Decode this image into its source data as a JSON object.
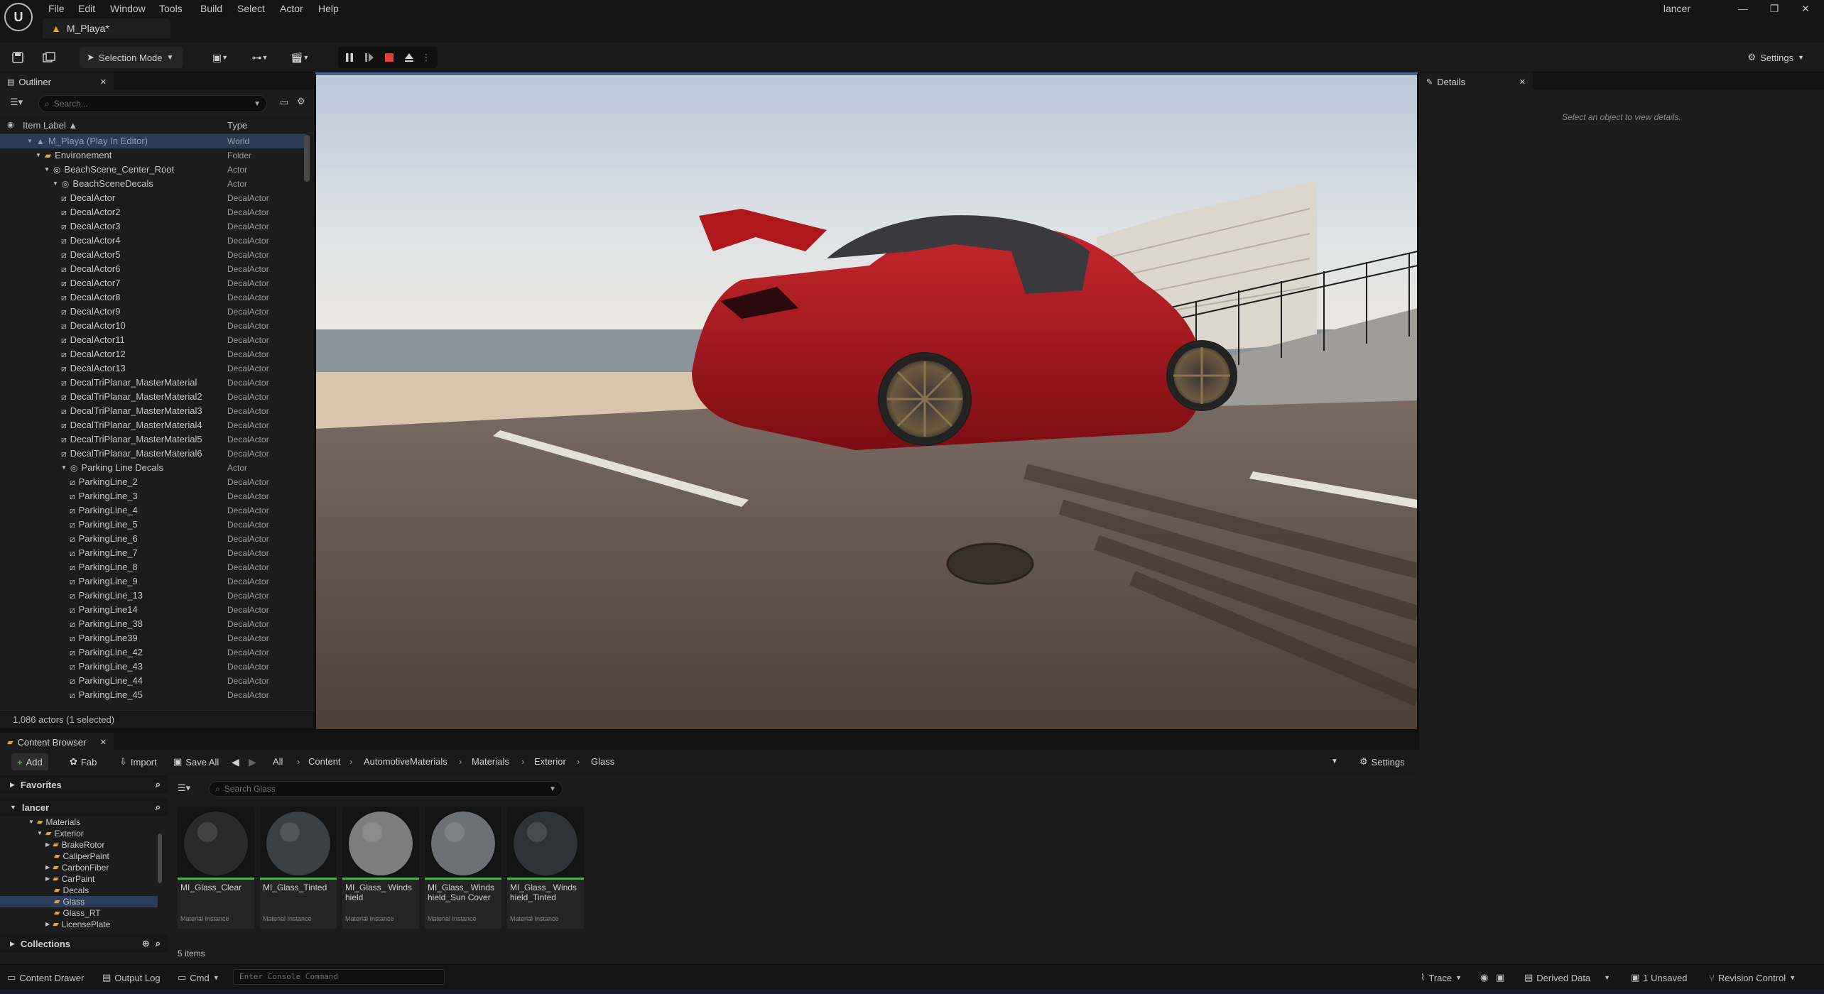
{
  "menu": [
    "File",
    "Edit",
    "Window",
    "Tools",
    "Build",
    "Select",
    "Actor",
    "Help"
  ],
  "level_tab": "M_Playa*",
  "user": "lancer",
  "toolbar": {
    "selection_mode": "Selection Mode",
    "settings": "Settings"
  },
  "outliner": {
    "tab": "Outliner",
    "search_placeholder": "Search...",
    "col_label": "Item Label ▲",
    "col_type": "Type",
    "rows": [
      {
        "label": "M_Playa (Play In Editor)",
        "type": "World",
        "depth": 0,
        "kind": "world",
        "expanded": true
      },
      {
        "label": "Environement",
        "type": "Folder",
        "depth": 1,
        "kind": "folder",
        "expanded": true
      },
      {
        "label": "BeachScene_Center_Root",
        "type": "Actor",
        "depth": 2,
        "kind": "actor",
        "expanded": true
      },
      {
        "label": "BeachSceneDecals",
        "type": "Actor",
        "depth": 3,
        "kind": "actor",
        "expanded": true
      },
      {
        "label": "DecalActor",
        "type": "DecalActor",
        "depth": 4,
        "kind": "decal"
      },
      {
        "label": "DecalActor2",
        "type": "DecalActor",
        "depth": 4,
        "kind": "decal"
      },
      {
        "label": "DecalActor3",
        "type": "DecalActor",
        "depth": 4,
        "kind": "decal"
      },
      {
        "label": "DecalActor4",
        "type": "DecalActor",
        "depth": 4,
        "kind": "decal"
      },
      {
        "label": "DecalActor5",
        "type": "DecalActor",
        "depth": 4,
        "kind": "decal"
      },
      {
        "label": "DecalActor6",
        "type": "DecalActor",
        "depth": 4,
        "kind": "decal"
      },
      {
        "label": "DecalActor7",
        "type": "DecalActor",
        "depth": 4,
        "kind": "decal"
      },
      {
        "label": "DecalActor8",
        "type": "DecalActor",
        "depth": 4,
        "kind": "decal"
      },
      {
        "label": "DecalActor9",
        "type": "DecalActor",
        "depth": 4,
        "kind": "decal"
      },
      {
        "label": "DecalActor10",
        "type": "DecalActor",
        "depth": 4,
        "kind": "decal"
      },
      {
        "label": "DecalActor11",
        "type": "DecalActor",
        "depth": 4,
        "kind": "decal"
      },
      {
        "label": "DecalActor12",
        "type": "DecalActor",
        "depth": 4,
        "kind": "decal"
      },
      {
        "label": "DecalActor13",
        "type": "DecalActor",
        "depth": 4,
        "kind": "decal"
      },
      {
        "label": "DecalTriPlanar_MasterMaterial",
        "type": "DecalActor",
        "depth": 4,
        "kind": "decal"
      },
      {
        "label": "DecalTriPlanar_MasterMaterial2",
        "type": "DecalActor",
        "depth": 4,
        "kind": "decal"
      },
      {
        "label": "DecalTriPlanar_MasterMaterial3",
        "type": "DecalActor",
        "depth": 4,
        "kind": "decal"
      },
      {
        "label": "DecalTriPlanar_MasterMaterial4",
        "type": "DecalActor",
        "depth": 4,
        "kind": "decal"
      },
      {
        "label": "DecalTriPlanar_MasterMaterial5",
        "type": "DecalActor",
        "depth": 4,
        "kind": "decal"
      },
      {
        "label": "DecalTriPlanar_MasterMaterial6",
        "type": "DecalActor",
        "depth": 4,
        "kind": "decal"
      },
      {
        "label": "Parking Line Decals",
        "type": "Actor",
        "depth": 4,
        "kind": "actor",
        "expanded": true
      },
      {
        "label": "ParkingLine_2",
        "type": "DecalActor",
        "depth": 5,
        "kind": "decal"
      },
      {
        "label": "ParkingLine_3",
        "type": "DecalActor",
        "depth": 5,
        "kind": "decal"
      },
      {
        "label": "ParkingLine_4",
        "type": "DecalActor",
        "depth": 5,
        "kind": "decal"
      },
      {
        "label": "ParkingLine_5",
        "type": "DecalActor",
        "depth": 5,
        "kind": "decal"
      },
      {
        "label": "ParkingLine_6",
        "type": "DecalActor",
        "depth": 5,
        "kind": "decal"
      },
      {
        "label": "ParkingLine_7",
        "type": "DecalActor",
        "depth": 5,
        "kind": "decal"
      },
      {
        "label": "ParkingLine_8",
        "type": "DecalActor",
        "depth": 5,
        "kind": "decal"
      },
      {
        "label": "ParkingLine_9",
        "type": "DecalActor",
        "depth": 5,
        "kind": "decal"
      },
      {
        "label": "ParkingLine_13",
        "type": "DecalActor",
        "depth": 5,
        "kind": "decal"
      },
      {
        "label": "ParkingLine14",
        "type": "DecalActor",
        "depth": 5,
        "kind": "decal"
      },
      {
        "label": "ParkingLine_38",
        "type": "DecalActor",
        "depth": 5,
        "kind": "decal"
      },
      {
        "label": "ParkingLine39",
        "type": "DecalActor",
        "depth": 5,
        "kind": "decal"
      },
      {
        "label": "ParkingLine_42",
        "type": "DecalActor",
        "depth": 5,
        "kind": "decal"
      },
      {
        "label": "ParkingLine_43",
        "type": "DecalActor",
        "depth": 5,
        "kind": "decal"
      },
      {
        "label": "ParkingLine_44",
        "type": "DecalActor",
        "depth": 5,
        "kind": "decal"
      },
      {
        "label": "ParkingLine_45",
        "type": "DecalActor",
        "depth": 5,
        "kind": "decal"
      }
    ],
    "status": "1,086 actors (1 selected)"
  },
  "details": {
    "tab": "Details",
    "empty": "Select an object to view details."
  },
  "content_browser": {
    "tab": "Content Browser",
    "add": "Add",
    "fab": "Fab",
    "import": "Import",
    "save_all": "Save All",
    "settings": "Settings",
    "breadcrumb": [
      "All",
      "Content",
      "AutomotiveMaterials",
      "Materials",
      "Exterior",
      "Glass"
    ],
    "favorites": "Favorites",
    "project": "lancer",
    "collections": "Collections",
    "search_placeholder": "Search Glass",
    "tree": [
      {
        "label": "Materials",
        "depth": 0,
        "expanded": true
      },
      {
        "label": "Exterior",
        "depth": 1,
        "expanded": true
      },
      {
        "label": "BrakeRotor",
        "depth": 2,
        "expanded": false
      },
      {
        "label": "CaliperPaint",
        "depth": 2
      },
      {
        "label": "CarbonFiber",
        "depth": 2,
        "expanded": false
      },
      {
        "label": "CarPaint",
        "depth": 2,
        "expanded": false
      },
      {
        "label": "Decals",
        "depth": 2
      },
      {
        "label": "Glass",
        "depth": 2,
        "selected": true
      },
      {
        "label": "Glass_RT",
        "depth": 2
      },
      {
        "label": "LicensePlate",
        "depth": 2,
        "expanded": false
      }
    ],
    "assets": [
      {
        "name": "MI_Glass_Clear",
        "type": "Material Instance"
      },
      {
        "name": "MI_Glass_Tinted",
        "type": "Material Instance"
      },
      {
        "name": "MI_Glass_ Windshield",
        "type": "Material Instance"
      },
      {
        "name": "MI_Glass_ Windshield_Sun Cover",
        "type": "Material Instance"
      },
      {
        "name": "MI_Glass_ Windshield_Tinted",
        "type": "Material Instance"
      }
    ],
    "count": "5 items"
  },
  "statusbar": {
    "content_drawer": "Content Drawer",
    "output_log": "Output Log",
    "cmd": "Cmd",
    "console_placeholder": "Enter Console Command",
    "trace": "Trace",
    "derived_data": "Derived Data",
    "unsaved": "1 Unsaved",
    "revision_control": "Revision Control"
  },
  "colors": {
    "accent": "#2a6bd1",
    "selection": "#2a3d55",
    "stop": "#e23b3b",
    "asset_bar": "#4caf50",
    "car_red": "#a8141b"
  }
}
